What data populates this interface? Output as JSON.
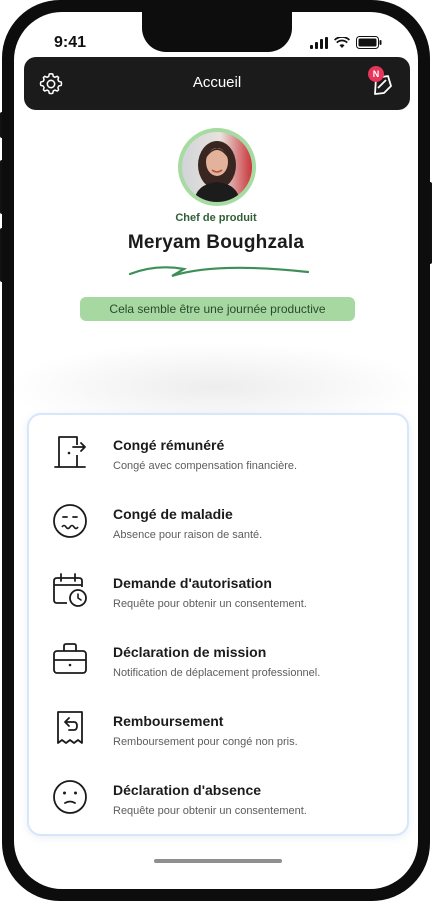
{
  "status_bar": {
    "time": "9:41"
  },
  "header": {
    "title": "Accueil",
    "notification_badge": "N"
  },
  "profile": {
    "role": "Chef de produit",
    "name": "Meryam Boughzala",
    "mood": "Cela semble être une journée productive"
  },
  "requests": [
    {
      "icon": "door-exit-icon",
      "title": "Congé rémunéré",
      "subtitle": "Congé avec compensation financière."
    },
    {
      "icon": "sick-face-icon",
      "title": "Congé de maladie",
      "subtitle": "Absence pour raison de santé."
    },
    {
      "icon": "calendar-clock-icon",
      "title": "Demande d'autorisation",
      "subtitle": "Requête pour obtenir un consentement."
    },
    {
      "icon": "briefcase-icon",
      "title": "Déclaration de mission",
      "subtitle": "Notification de déplacement professionnel."
    },
    {
      "icon": "receipt-refund-icon",
      "title": "Remboursement",
      "subtitle": "Remboursement pour congé non pris."
    },
    {
      "icon": "neutral-face-icon",
      "title": "Déclaration d'absence",
      "subtitle": "Requête pour obtenir un consentement."
    }
  ],
  "colors": {
    "accent_green": "#a7d8a1",
    "dark_bar": "#1b1b1b",
    "badge_red": "#e8365a",
    "card_border": "#d6e6fb"
  }
}
